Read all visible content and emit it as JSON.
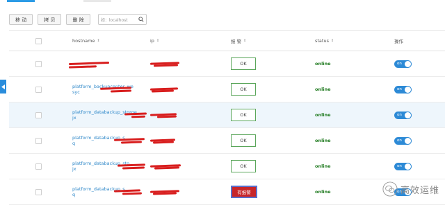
{
  "toolbar": {
    "move_label": "移 动",
    "copy_label": "拷 贝",
    "delete_label": "删 除",
    "search_placeholder": "如：localhost"
  },
  "table": {
    "headers": {
      "hostname": "hostname",
      "ip": "ip",
      "alarm": "报 警",
      "status": "status",
      "operation": "操作"
    },
    "rows": [
      {
        "hostname": "",
        "alarm": "OK",
        "alarm_state": "ok",
        "status": "online",
        "toggle": "on"
      },
      {
        "hostname": "platform_backupcenter_we\nsyc",
        "alarm": "OK",
        "alarm_state": "ok",
        "status": "online",
        "toggle": "on"
      },
      {
        "hostname": "platform_databackup_storge\njx",
        "alarm": "OK",
        "alarm_state": "ok",
        "status": "online",
        "toggle": "on"
      },
      {
        "hostname": "platform_databackup_s\nq",
        "alarm": "OK",
        "alarm_state": "ok",
        "status": "online",
        "toggle": "on"
      },
      {
        "hostname": "platform_databackup_sto\njx",
        "alarm": "OK",
        "alarm_state": "ok",
        "status": "online",
        "toggle": "on"
      },
      {
        "hostname": "platform_databackup_s\nq",
        "alarm": "有报警",
        "alarm_state": "alarm",
        "status": "online",
        "toggle": "on"
      }
    ]
  },
  "watermark": {
    "text": "高效运维"
  },
  "colors": {
    "accent": "#2d8ad6",
    "ok_border": "#5aa65a",
    "alarm_bg": "#c7262a",
    "status_green": "#1f7a1f"
  }
}
